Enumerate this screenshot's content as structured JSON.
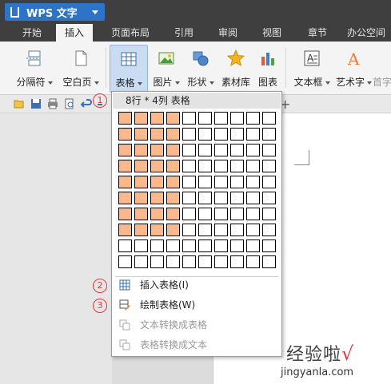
{
  "app": {
    "title": "WPS 文字"
  },
  "tabs": [
    "开始",
    "插入",
    "页面布局",
    "引用",
    "审阅",
    "视图",
    "章节",
    "办公空间"
  ],
  "active_tab": "插入",
  "ribbon": {
    "page_break": "分隔符",
    "blank_page": "空白页",
    "table": "表格",
    "picture": "图片",
    "shape": "形状",
    "material": "素材库",
    "chart": "图表",
    "textbox": "文本框",
    "wordart": "艺术字",
    "first_letter": "首字"
  },
  "table_menu": {
    "header": "8行 * 4列 表格",
    "grid": {
      "rows": 10,
      "cols": 10,
      "selected_rows": 8,
      "selected_cols": 4
    },
    "items": [
      {
        "label": "插入表格(I)",
        "enabled": true
      },
      {
        "label": "绘制表格(W)",
        "enabled": true
      },
      {
        "label": "文本转换成表格",
        "enabled": false
      },
      {
        "label": "表格转换成文本",
        "enabled": false
      }
    ]
  },
  "markers": [
    "1",
    "2",
    "3"
  ],
  "watermark": {
    "text": "经验啦",
    "check": "√",
    "url": "jingyanla.com"
  },
  "colors": {
    "accent": "#2d74c8",
    "highlight_cell": "#fbb88a",
    "marker": "#e0393e"
  }
}
